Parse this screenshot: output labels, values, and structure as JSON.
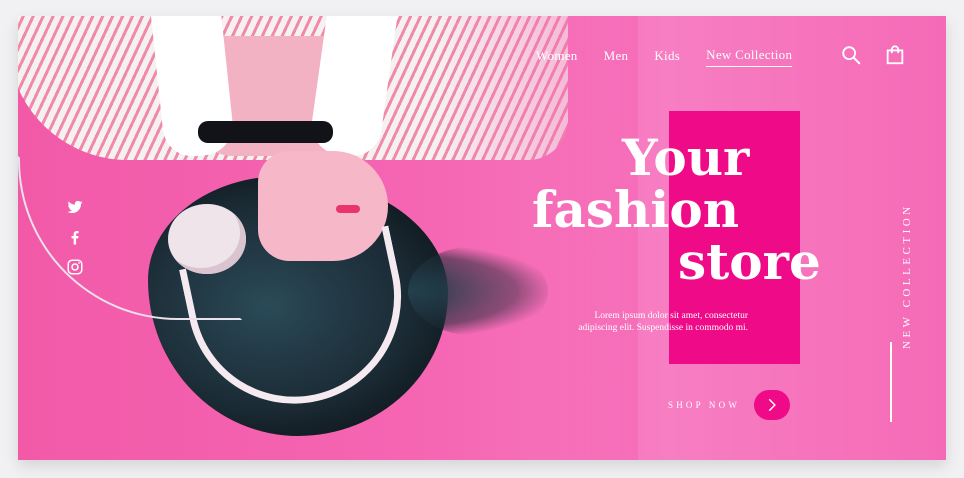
{
  "nav": {
    "items": [
      {
        "label": "Women"
      },
      {
        "label": "Men"
      },
      {
        "label": "Kids"
      },
      {
        "label": "New Collection",
        "active": true
      }
    ]
  },
  "icons": {
    "search": "search-icon",
    "bag": "shopping-bag-icon",
    "social": [
      "twitter-icon",
      "facebook-icon",
      "instagram-icon"
    ]
  },
  "hero": {
    "title_lines": [
      "Your",
      "fashion",
      "store"
    ],
    "text": "Lorem ipsum dolor sit amet, consectetur adipiscing elit. Suspendisse in commodo mi.",
    "cta_label": "SHOP NOW"
  },
  "side_label": "NEW COLLECTION",
  "colors": {
    "background": "#f566b3",
    "accent": "#ef0a87",
    "text": "#ffffff"
  }
}
